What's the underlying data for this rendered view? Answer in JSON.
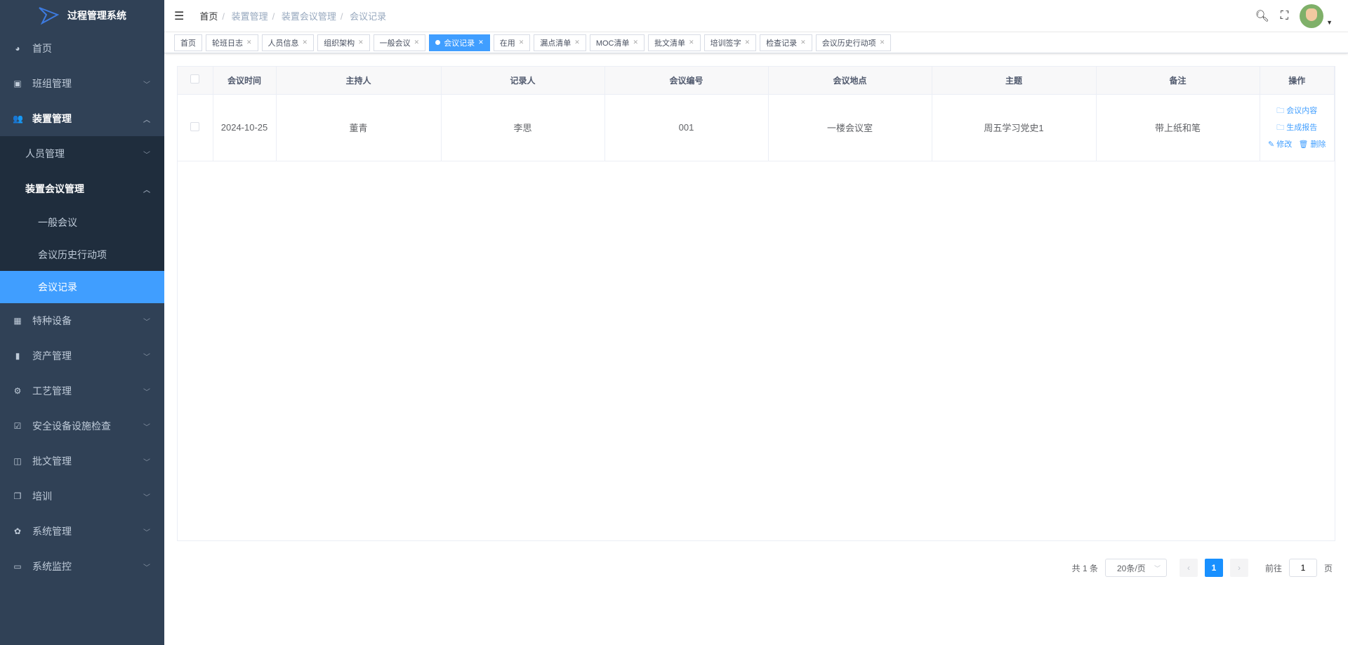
{
  "app": {
    "title": "过程管理系统"
  },
  "sidebar": {
    "items": [
      {
        "label": "首页",
        "icon": "dashboard-icon"
      },
      {
        "label": "班组管理",
        "icon": "team-icon"
      },
      {
        "label": "装置管理",
        "icon": "people-icon"
      },
      {
        "label": "人员管理"
      },
      {
        "label": "装置会议管理"
      },
      {
        "label": "一般会议"
      },
      {
        "label": "会议历史行动项"
      },
      {
        "label": "会议记录"
      },
      {
        "label": "特种设备",
        "icon": "table-icon"
      },
      {
        "label": "资产管理",
        "icon": "chart-icon"
      },
      {
        "label": "工艺管理",
        "icon": "process-icon"
      },
      {
        "label": "安全设备设施检查",
        "icon": "checkbox-icon"
      },
      {
        "label": "批文管理",
        "icon": "book-icon"
      },
      {
        "label": "培训",
        "icon": "copy-icon"
      },
      {
        "label": "系统管理",
        "icon": "gear-icon"
      },
      {
        "label": "系统监控",
        "icon": "monitor-icon"
      }
    ]
  },
  "breadcrumb": [
    "首页",
    "装置管理",
    "装置会议管理",
    "会议记录"
  ],
  "tags": [
    "首页",
    "轮班日志",
    "人员信息",
    "组织架构",
    "一般会议",
    "会议记录",
    "在用",
    "漏点清单",
    "MOC清单",
    "批文清单",
    "培训签字",
    "检查记录",
    "会议历史行动项"
  ],
  "table": {
    "headers": [
      "会议时间",
      "主持人",
      "记录人",
      "会议编号",
      "会议地点",
      "主题",
      "备注",
      "操作"
    ],
    "rows": [
      {
        "cells": [
          "2024-10-25",
          "董青",
          "李思",
          "001",
          "一楼会议室",
          "周五学习党史1",
          "带上纸和笔"
        ]
      }
    ],
    "actions": {
      "content": "会议内容",
      "report": "生成报告",
      "edit": "修改",
      "delete": "删除"
    }
  },
  "pagination": {
    "total": "共 1 条",
    "page_size": "20条/页",
    "current": "1",
    "goto_label": "前往",
    "goto_value": "1",
    "page_suffix": "页"
  },
  "colors": {
    "accent": "#409eff",
    "sidebar": "#304156",
    "submenu": "#1f2d3d"
  }
}
